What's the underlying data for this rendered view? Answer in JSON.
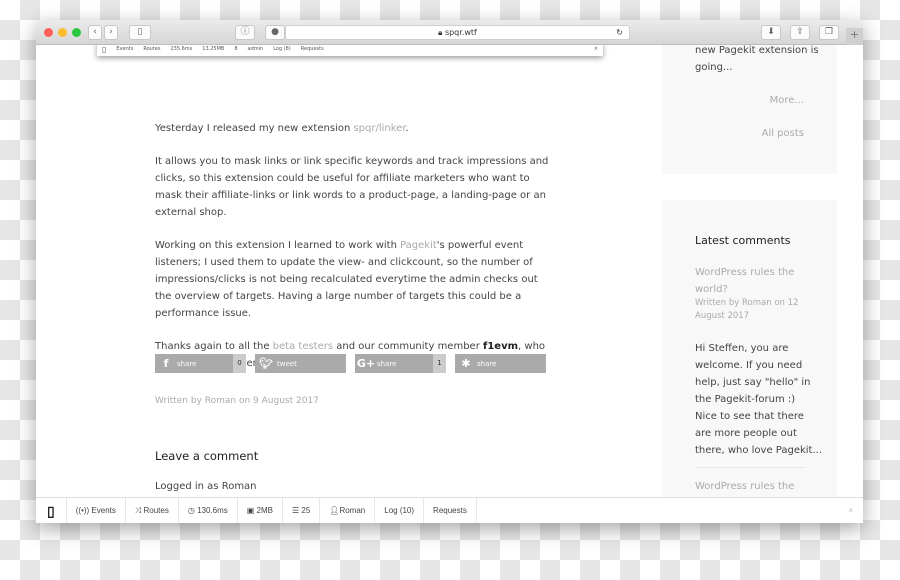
{
  "browser": {
    "url": "spqr.wtf",
    "colors": {
      "close": "#fc5f57",
      "minimize": "#fdbc2e",
      "zoom": "#28c840"
    }
  },
  "mini_toolbar": {
    "items": [
      "Events",
      "Routes",
      "235.6ms",
      "13.25MB",
      "8",
      "admin",
      "Log (8)",
      "Requests"
    ]
  },
  "article": {
    "p1": {
      "before": "Yesterday I released my new extension ",
      "link": "spqr/linker",
      "after": "."
    },
    "p2": "It allows you to mask links or link specific keywords and track impressions and clicks, so this extension could be useful for affiliate marketers who want to mask their affiliate-links or link words to a product-page, a landing-page or an external shop.",
    "p3": {
      "before": "Working on this extension I learned to work with ",
      "link": "Pagekit",
      "after": "'s powerful event listeners; I used them to update the view- and clickcount, so the number of impressions/clicks is not being recalculated everytime the admin checks out the overview of targets. Having a large number of targets this could be a performance issue."
    },
    "p4": {
      "before": "Thanks again to all the ",
      "link": "beta testers",
      "mid": " and our community member ",
      "bold": "f1evm",
      "after": ", who translated this extension to French."
    },
    "shares": [
      {
        "icon": "facebook-icon",
        "glyph": "f",
        "label": "share",
        "count": "0"
      },
      {
        "icon": "twitter-icon",
        "glyph": "✓",
        "label": "tweet"
      },
      {
        "icon": "google-plus-icon",
        "glyph": "G+",
        "label": "share",
        "count": "1"
      },
      {
        "icon": "asterisk-icon",
        "glyph": "✱",
        "label": "share"
      }
    ],
    "meta": "Written by Roman on 9 August 2017",
    "leave_comment": "Leave a comment",
    "logged_in": "Logged in as Roman"
  },
  "sidebar": {
    "excerpt_end1": "new Pagekit extension is",
    "excerpt_end2": "going...",
    "more": "More...",
    "all_posts": "All posts",
    "latest_title": "Latest comments",
    "comment1": {
      "title1": "WordPress rules the",
      "title2": "world?",
      "meta1": "Written by Roman on 12",
      "meta2": "August 2017",
      "lines": [
        "Hi Steffen, you are",
        "welcome. If you need",
        "help, just say \"hello\" in",
        "the Pagekit-forum :)",
        "Nice to see that there",
        "are more people out",
        "there, who love Pagekit..."
      ]
    },
    "comment2_title": "WordPress rules the"
  },
  "debugbar": {
    "events": "Events",
    "routes": "Routes",
    "time": "130.6ms",
    "memory": "2MB",
    "queries": "25",
    "user": "Roman",
    "log": "Log (10)",
    "requests": "Requests"
  }
}
